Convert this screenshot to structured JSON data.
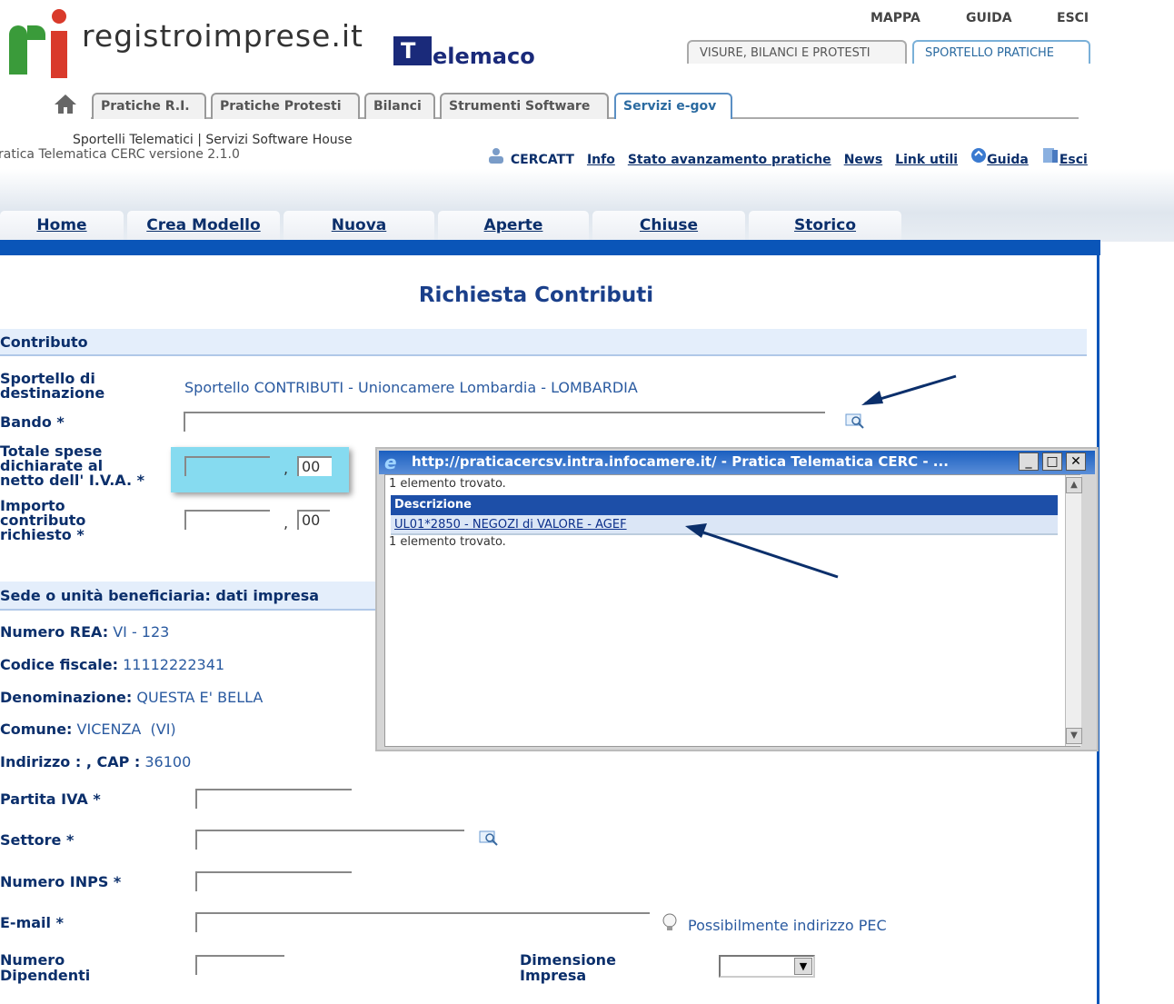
{
  "header": {
    "brand": "registroimprese.it",
    "telemaco": "elemaco",
    "topmenu": [
      "MAPPA",
      "GUIDA",
      "ESCI"
    ],
    "toptabs": [
      "VISURE, BILANCI E PROTESTI",
      "SPORTELLO PRATICHE"
    ],
    "navtabs": [
      "Pratiche R.I.",
      "Pratiche Protesti",
      "Bilanci",
      "Strumenti Software",
      "Servizi e-gov"
    ],
    "subtitle1": "Sportelli Telematici | Servizi Software House",
    "subtitle2": "ratica Telematica CERC versione 2.1.0",
    "links": [
      "CERCATT",
      "Info",
      "Stato avanzamento pratiche",
      "News",
      "Link utili",
      "Guida",
      "Esci"
    ]
  },
  "menu": [
    "Home",
    "Crea Modello",
    "Nuova",
    "Aperte",
    "Chiuse",
    "Storico"
  ],
  "form": {
    "title": "Richiesta Contributi",
    "section1": "Contributo",
    "sportello_label1": "Sportello di",
    "sportello_label2": "destinazione",
    "sportello_value": "Sportello CONTRIBUTI - Unioncamere Lombardia - LOMBARDIA",
    "bando_label": "Bando *",
    "spese_label1": "Totale spese",
    "spese_label2": "dichiarate al",
    "spese_label3": "netto dell' I.V.A. *",
    "spese_comma": ",",
    "spese_cents": "00",
    "importo_label1": "Importo",
    "importo_label2": "contributo",
    "importo_label3": "richiesto *",
    "importo_comma": ",",
    "importo_cents": "00",
    "section2": "Sede o unità beneficiaria: dati impresa",
    "rea_label": "Numero REA:",
    "rea_value": "VI - 123",
    "cf_label": "Codice fiscale:",
    "cf_value": "11112222341",
    "den_label": "Denominazione:",
    "den_value": "QUESTA E' BELLA",
    "comune_label": "Comune:",
    "comune_value": "VICENZA  (VI)",
    "indirizzo_label": "Indirizzo : , CAP :",
    "indirizzo_value": "36100",
    "piva_label": "Partita IVA *",
    "settore_label": "Settore *",
    "inps_label": "Numero INPS *",
    "email_label": "E-mail *",
    "pec_hint": "Possibilmente indirizzo PEC",
    "dip_label1": "Numero",
    "dip_label2": "Dipendenti",
    "dim_label1": "Dimensione",
    "dim_label2": "Impresa"
  },
  "popup": {
    "title": "http://praticacercsv.intra.infocamere.it/ - Pratica Telematica CERC - ...",
    "found_top": "1 elemento trovato.",
    "column": "Descrizione",
    "row": "UL01*2850 - NEGOZI di VALORE - AGEF",
    "found_bottom": "1 elemento trovato."
  }
}
